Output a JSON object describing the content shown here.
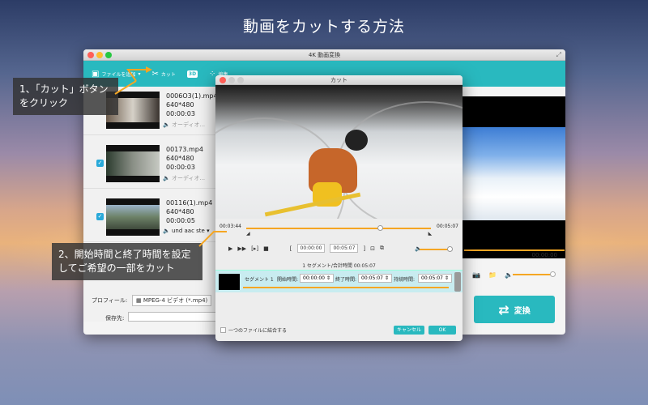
{
  "headline": "動画をカットする方法",
  "main_window": {
    "title": "4K 動画変換",
    "toolbar": {
      "add_file": "ファイルを追加",
      "cut": "カット",
      "badge_3d": "3D",
      "edit": "編集"
    },
    "files": [
      {
        "name": "0006O3(1).mp4",
        "resolution": "640*480",
        "duration": "00:00:03",
        "audio": "オーディオ..."
      },
      {
        "name": "00173.mp4",
        "resolution": "640*480",
        "duration": "00:00:03",
        "audio": "オーディオ..."
      },
      {
        "name": "00116(1).mp4",
        "resolution": "640*480",
        "duration": "00:00:05",
        "audio": "und aac ste"
      }
    ],
    "profile_label": "プロフィール:",
    "profile_value": "MPEG-4 ビデオ (*.mp4)",
    "save_label": "保存先:",
    "preview_time": "00:00:00",
    "convert_label": "変換"
  },
  "cut_dialog": {
    "title": "カット",
    "current_time": "00:03:44",
    "total_time": "00:05:07",
    "start_field": "00:00:00",
    "end_field": "00:05:07",
    "segment_info": "1 セグメント/合計時間 00:05:07",
    "segment": {
      "name": "セグメント 1",
      "start_label": "開始時間:",
      "start_value": "00:00:00",
      "end_label": "終了時間:",
      "end_value": "00:05:07",
      "duration_label": "持続時間:",
      "duration_value": "00:05:07"
    },
    "merge_label": "一つのファイルに結合する",
    "cancel_label": "キャンセル",
    "ok_label": "OK"
  },
  "callouts": {
    "step1": "1、「カット」ボタンをクリック",
    "step2": "2、開始時間と終了時間を設定してご希望の一部をカット"
  },
  "colors": {
    "accent": "#29b9bf",
    "timeline": "#f5a623"
  }
}
